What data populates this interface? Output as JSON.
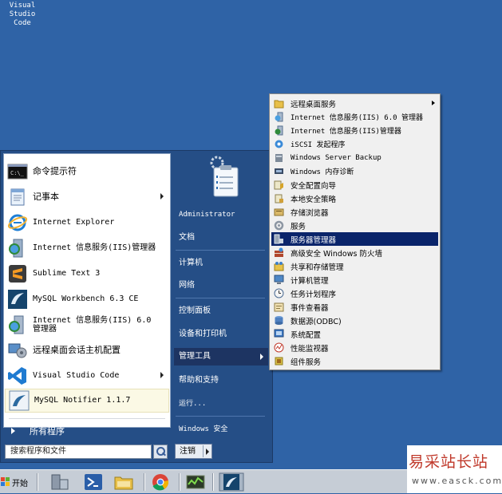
{
  "desktop": {
    "icon_label_line1": "Visual",
    "icon_label_line2": "Studio Code"
  },
  "start_menu": {
    "programs": [
      {
        "label": "命令提示符",
        "icon": "cmd-icon",
        "has_arrow": false
      },
      {
        "label": "记事本",
        "icon": "notepad-icon",
        "has_arrow": true
      },
      {
        "label": "Internet Explorer",
        "icon": "ie-icon",
        "has_arrow": false
      },
      {
        "label": "Internet 信息服务(IIS)管理器",
        "icon": "iis-icon",
        "has_arrow": false
      },
      {
        "label": "Sublime Text 3",
        "icon": "sublime-icon",
        "has_arrow": false
      },
      {
        "label": "MySQL Workbench 6.3 CE",
        "icon": "mysql-workbench-icon",
        "has_arrow": false
      },
      {
        "label_line1": "Internet 信息服务(IIS) 6.0",
        "label_line2": "管理器",
        "icon": "iis6-icon",
        "has_arrow": false
      },
      {
        "label": "远程桌面会话主机配置",
        "icon": "remote-desktop-icon",
        "has_arrow": false
      },
      {
        "label": "Visual Studio Code",
        "icon": "vscode-icon",
        "has_arrow": true
      },
      {
        "label": "MySQL Notifier 1.1.7",
        "icon": "mysql-notifier-icon",
        "has_arrow": false,
        "highlighted": true
      }
    ],
    "all_programs_label": "所有程序",
    "search_placeholder": "搜索程序和文件",
    "right_items": [
      {
        "label": "Administrator"
      },
      {
        "label": "文档"
      },
      {
        "label": "计算机"
      },
      {
        "label": "网络"
      },
      {
        "label": "控制面板"
      },
      {
        "label": "设备和打印机"
      },
      {
        "label": "管理工具",
        "active": true
      },
      {
        "label": "帮助和支持"
      },
      {
        "label": "运行..."
      },
      {
        "label": "Windows 安全"
      }
    ],
    "logoff_label": "注销"
  },
  "submenu": {
    "items": [
      {
        "label": "远程桌面服务",
        "icon": "folder-icon",
        "has_arrow": true
      },
      {
        "label": "Internet 信息服务(IIS) 6.0 管理器",
        "icon": "iis6-mgr-icon"
      },
      {
        "label": "Internet 信息服务(IIS)管理器",
        "icon": "iis-mgr-icon"
      },
      {
        "label": "iSCSI 发起程序",
        "icon": "iscsi-icon"
      },
      {
        "label": "Windows Server Backup",
        "icon": "backup-icon"
      },
      {
        "label": "Windows 内存诊断",
        "icon": "memory-icon"
      },
      {
        "label": "安全配置向导",
        "icon": "security-wizard-icon"
      },
      {
        "label": "本地安全策略",
        "icon": "local-policy-icon"
      },
      {
        "label": "存储浏览器",
        "icon": "storage-icon"
      },
      {
        "label": "服务",
        "icon": "services-icon"
      },
      {
        "label": "服务器管理器",
        "icon": "server-manager-icon",
        "selected": true
      },
      {
        "label": "高级安全 Windows 防火墙",
        "icon": "firewall-icon"
      },
      {
        "label": "共享和存储管理",
        "icon": "share-icon"
      },
      {
        "label": "计算机管理",
        "icon": "computer-mgmt-icon"
      },
      {
        "label": "任务计划程序",
        "icon": "task-scheduler-icon"
      },
      {
        "label": "事件查看器",
        "icon": "event-viewer-icon"
      },
      {
        "label": "数据源(ODBC)",
        "icon": "odbc-icon"
      },
      {
        "label": "系统配置",
        "icon": "msconfig-icon"
      },
      {
        "label": "性能监视器",
        "icon": "perfmon-icon"
      },
      {
        "label": "组件服务",
        "icon": "component-services-icon"
      }
    ]
  },
  "taskbar": {
    "start_label": "开始"
  },
  "watermark": {
    "title": "易采站长站",
    "url": "www.easck.com"
  },
  "colors": {
    "desktop": "#2f63a6",
    "start_menu_frame": "#254e86",
    "selection": "#0a246a",
    "active_right_item": "#1d3462",
    "watermark_red": "#c0392b"
  }
}
